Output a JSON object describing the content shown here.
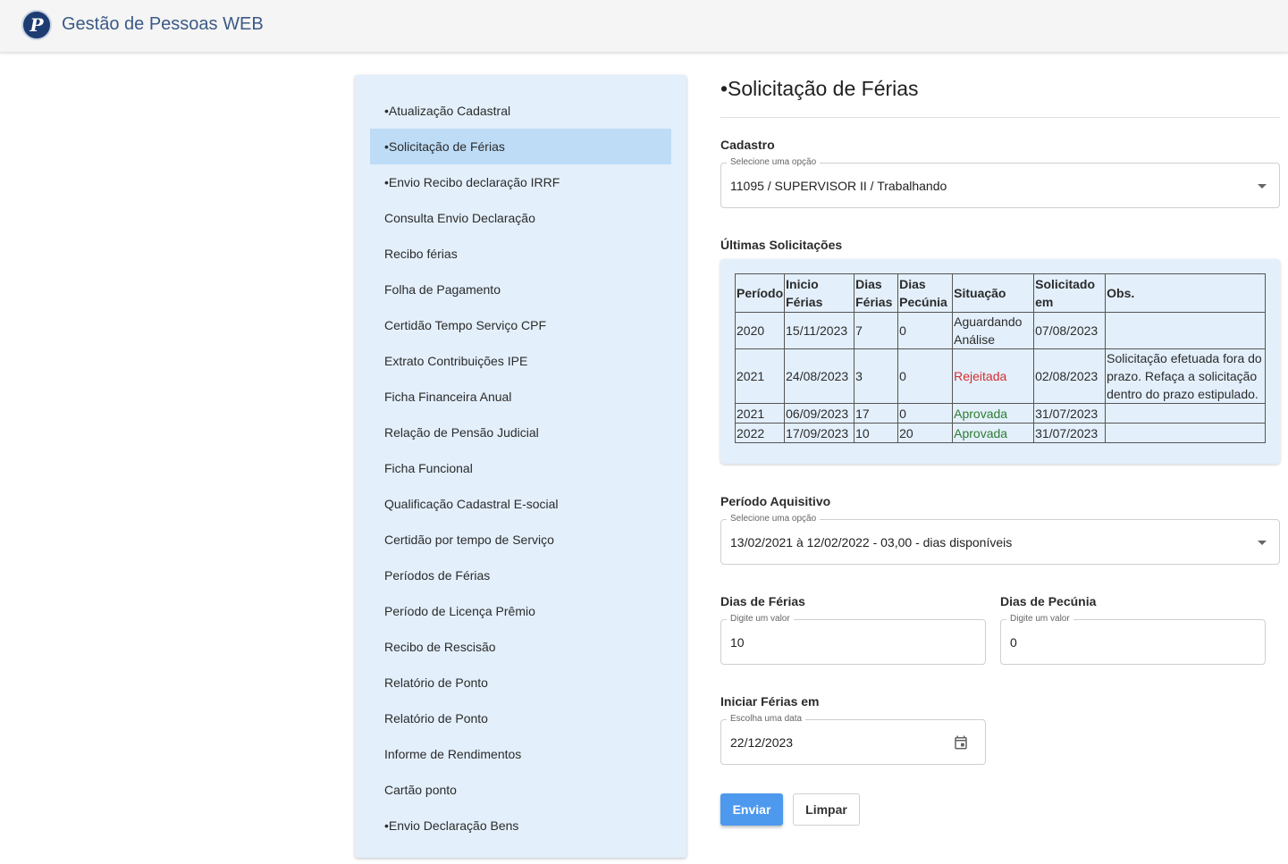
{
  "header": {
    "title": "Gestão de Pessoas WEB",
    "logo_letter": "P",
    "logo_icon": "company-logo"
  },
  "sidebar": {
    "items": [
      {
        "label": "•Atualização Cadastral"
      },
      {
        "label": "•Solicitação de Férias",
        "active": true
      },
      {
        "label": "•Envio Recibo declaração IRRF"
      },
      {
        "label": "Consulta Envio Declaração"
      },
      {
        "label": "Recibo férias"
      },
      {
        "label": "Folha de Pagamento"
      },
      {
        "label": "Certidão Tempo Serviço CPF"
      },
      {
        "label": "Extrato Contribuições IPE"
      },
      {
        "label": "Ficha Financeira Anual"
      },
      {
        "label": "Relação de Pensão Judicial"
      },
      {
        "label": "Ficha Funcional"
      },
      {
        "label": "Qualificação Cadastral E-social"
      },
      {
        "label": "Certidão por tempo de Serviço"
      },
      {
        "label": "Períodos de Férias"
      },
      {
        "label": "Período de Licença Prêmio"
      },
      {
        "label": "Recibo de Rescisão"
      },
      {
        "label": "Relatório de Ponto"
      },
      {
        "label": "Relatório de Ponto"
      },
      {
        "label": "Informe de Rendimentos"
      },
      {
        "label": "Cartão ponto"
      },
      {
        "label": "•Envio Declaração Bens"
      }
    ]
  },
  "main": {
    "title": "•Solicitação de Férias",
    "cadastro": {
      "label": "Cadastro",
      "float_label": "Selecione uma opção",
      "value": "11095 / SUPERVISOR II / Trabalhando"
    },
    "ultimas": {
      "label": "Últimas Solicitações",
      "headers": [
        "Período",
        "Inicio Férias",
        "Dias Férias",
        "Dias Pecúnia",
        "Situação",
        "Solicitado em",
        "Obs."
      ],
      "rows": [
        [
          "2020",
          "15/11/2023",
          "7",
          "0",
          "Aguardando Análise",
          "07/08/2023",
          ""
        ],
        [
          "2021",
          "24/08/2023",
          "3",
          "0",
          "Rejeitada",
          "02/08/2023",
          "Solicitação efetuada fora do prazo. Refaça a solicitação dentro do prazo estipulado."
        ],
        [
          "2021",
          "06/09/2023",
          "17",
          "0",
          "Aprovada",
          "31/07/2023",
          ""
        ],
        [
          "2022",
          "17/09/2023",
          "10",
          "20",
          "Aprovada",
          "31/07/2023",
          ""
        ]
      ],
      "status_colors": {
        "Rejeitada": "#d32f2f",
        "Aprovada": "#2e7d32"
      }
    },
    "periodo": {
      "label": "Período Aquisitivo",
      "float_label": "Selecione uma opção",
      "value": "13/02/2021 à 12/02/2022 - 03,00 - dias disponíveis"
    },
    "dias_ferias": {
      "label": "Dias de Férias",
      "float_label": "Digite um valor",
      "value": "10"
    },
    "dias_pecunia": {
      "label": "Dias de Pecúnia",
      "float_label": "Digite um valor",
      "value": "0"
    },
    "iniciar": {
      "label": "Iniciar Férias em",
      "float_label": "Escolha uma data",
      "value": "22/12/2023",
      "icon": "calendar-icon"
    },
    "buttons": {
      "submit": "Enviar",
      "clear": "Limpar"
    }
  },
  "colors": {
    "accent": "#4d99ed",
    "sidebar_bg": "#e3effb",
    "sidebar_active": "#bedcf6",
    "header_text": "#3b5a86"
  }
}
